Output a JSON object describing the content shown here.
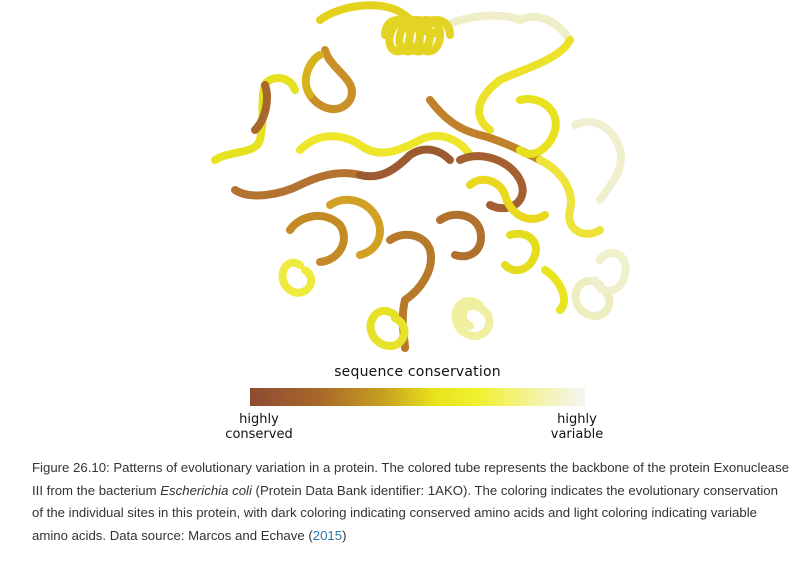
{
  "figure": {
    "image_description_icon": "protein-tube-icon",
    "gradient_colors": [
      "#8e4b33",
      "#a7662a",
      "#c8a020",
      "#e7e21c",
      "#f0f02e",
      "#f3f3a0",
      "#f4f4f4"
    ]
  },
  "legend": {
    "title": "sequence conservation",
    "left_line1": "highly",
    "left_line2": "conserved",
    "right_line1": "highly",
    "right_line2": "variable"
  },
  "caption": {
    "part1": "Figure 26.10: Patterns of evolutionary variation in a protein. The colored tube represents the backbone of the protein Exonuclease III from the bacterium ",
    "species": "Escherichia coli",
    "part2": " (Protein Data Bank identifier: 1AKO). The coloring indicates the evolutionary conservation of the individual sites in this protein, with dark coloring indicating conserved amino acids and light coloring indicating variable amino acids. Data source: Marcos and Echave (",
    "year_link": "2015",
    "part3": ")"
  }
}
